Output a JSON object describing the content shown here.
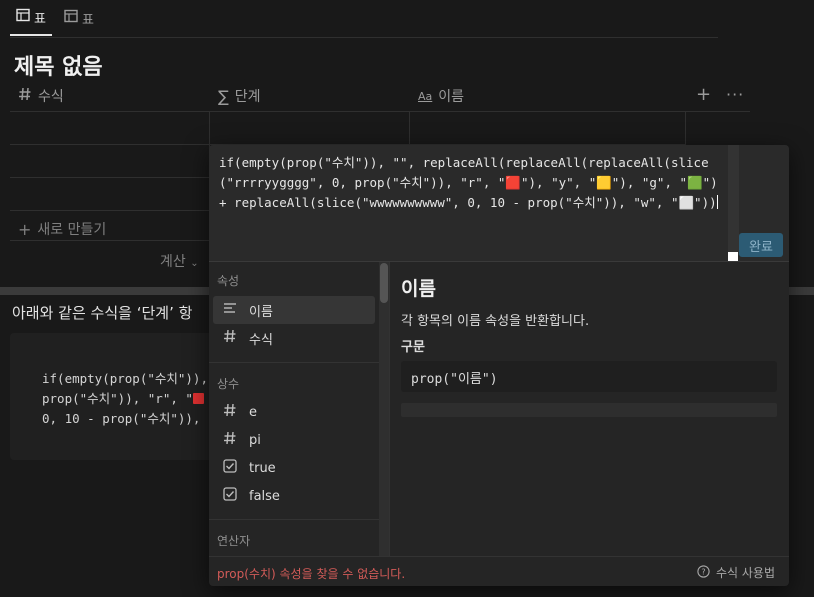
{
  "tabs": [
    {
      "label": "표",
      "active": true
    },
    {
      "label": "표",
      "active": false
    }
  ],
  "page_title": "제목 없음",
  "columns": [
    {
      "label": "수식",
      "icon": "hash-icon"
    },
    {
      "label": "단계",
      "icon": "sigma-icon"
    },
    {
      "label": "이름",
      "icon": "text-aa-icon"
    }
  ],
  "table": {
    "add_column": "+",
    "more": "···",
    "new_row": "새로 만들기",
    "calculate": "계산"
  },
  "paragraph": "아래와 같은 수식을 ‘단계’ 항",
  "code_block": {
    "line1": "if(empty(prop(\"수치\")),",
    "line2": "prop(\"수치\")), \"r\", \"",
    "line3": "0, 10 - prop(\"수치\")),"
  },
  "formula_editor": {
    "formula": "if(empty(prop(\"수치\")), \"\", replaceAll(replaceAll(replaceAll(slice(\"rrrryygggg\", 0, prop(\"수치\")), \"r\", \"🟥\"), \"y\", \"🟨\"), \"g\", \"🟩\") + replaceAll(slice(\"wwwwwwwwww\", 0, 10 - prop(\"수치\")), \"w\", \"⬜\"))",
    "done_label": "완료",
    "sections": {
      "properties": "속성",
      "constants": "상수",
      "operators": "연산자"
    },
    "property_items": [
      {
        "label": "이름",
        "icon": "text-lines-icon",
        "selected": true
      },
      {
        "label": "수식",
        "icon": "hash-icon",
        "selected": false
      }
    ],
    "constant_items": [
      {
        "label": "e",
        "icon": "hash-icon"
      },
      {
        "label": "pi",
        "icon": "hash-icon"
      },
      {
        "label": "true",
        "icon": "checkbox-icon"
      },
      {
        "label": "false",
        "icon": "checkbox-icon"
      }
    ],
    "doc": {
      "title": "이름",
      "description": "각 항목의 이름 속성을 반환합니다.",
      "syntax_heading": "구문",
      "example": "prop(\"이름\")"
    },
    "error": "prop(수치) 속성을 찾을 수 없습니다.",
    "help": "수식 사용법"
  },
  "colors": {
    "background": "#191919",
    "editor_bg": "#252525",
    "done_button": "#2c5b74",
    "error_text": "#d35b58",
    "string_literal": "#b9d07a",
    "number_literal": "#d68e77"
  }
}
